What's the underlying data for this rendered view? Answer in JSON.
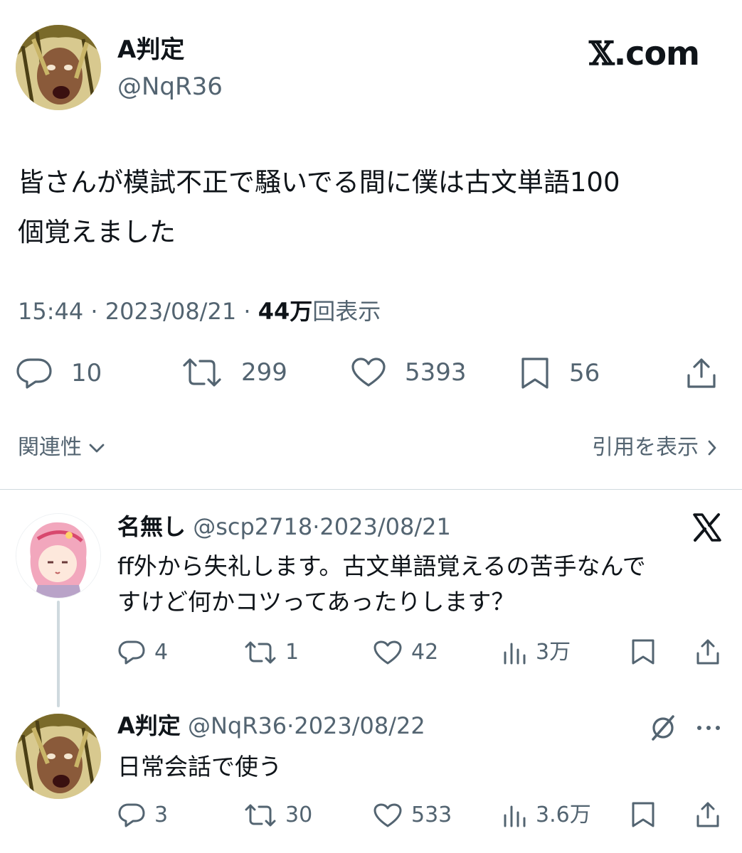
{
  "main_tweet": {
    "display_name": "A判定",
    "handle": "@NqR36",
    "brand": {
      "x": "𝕏",
      "suffix": ".com"
    },
    "text_line1": "皆さんが模試不正で騒いでる間に僕は古文単語100",
    "text_line2": "個覚えました",
    "time": "15:44",
    "sep1": "·",
    "date": "2023/08/21",
    "sep2": "·",
    "views_count": "44万",
    "views_label": "回表示",
    "replies": "10",
    "retweets": "299",
    "likes": "5393",
    "bookmarks": "56"
  },
  "relevance": {
    "label": "関連性",
    "icon": "chevron-down-icon"
  },
  "quotes_link": {
    "label": "引用を表示",
    "icon": "chevron-right-icon"
  },
  "replies": [
    {
      "display_name": "名無し",
      "handle": "@scp2718",
      "sep": "·",
      "date": "2023/08/21",
      "text_line1": "ff外から失礼します。古文単語覚えるの苦手なんで",
      "text_line2": "すけど何かコツってあったりします？",
      "replies": "4",
      "retweets": "1",
      "likes": "42",
      "views": "3万"
    },
    {
      "display_name": "A判定",
      "handle": "@NqR36",
      "sep": "·",
      "date": "2023/08/22",
      "text_line1": "日常会話で使う",
      "replies": "3",
      "retweets": "30",
      "likes": "533",
      "views": "3.6万"
    }
  ],
  "colors": {
    "text": "#0f1419",
    "secondary": "#536471",
    "divider": "#cfd9de"
  }
}
